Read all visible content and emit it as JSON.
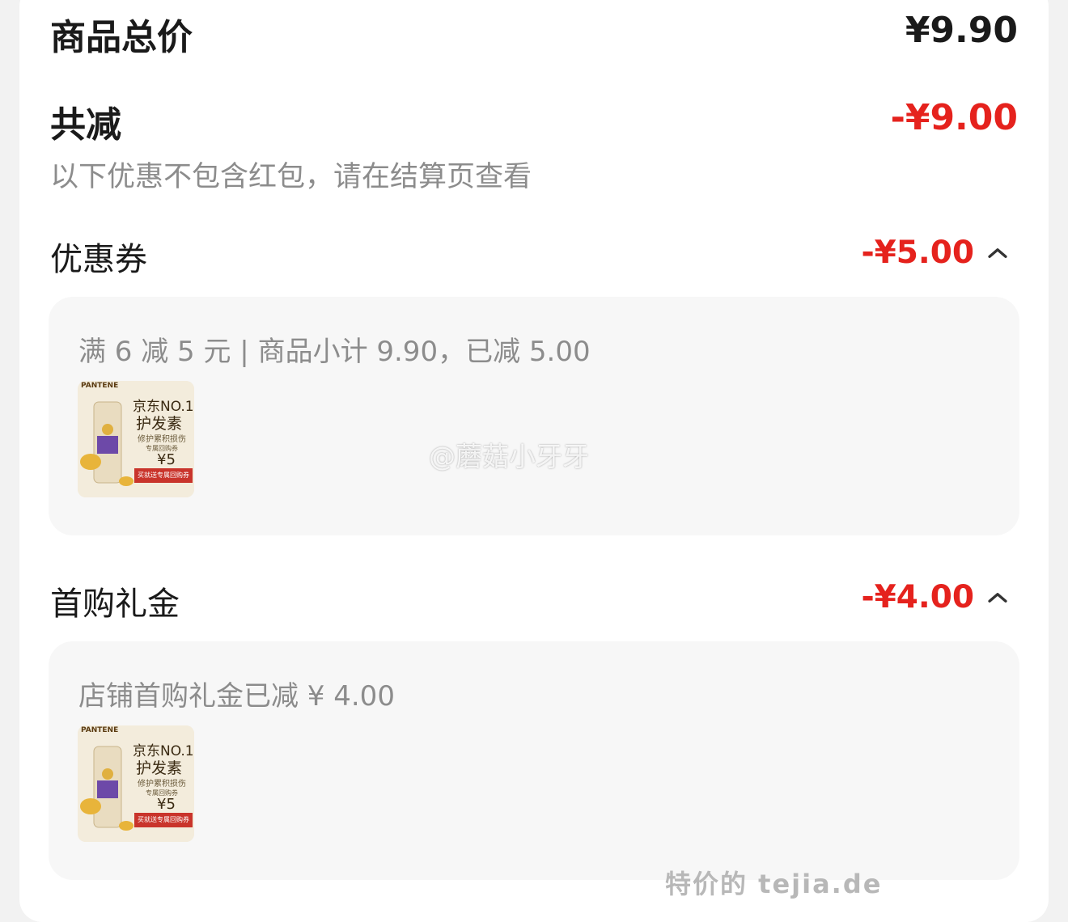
{
  "summary": {
    "total_label": "商品总价",
    "total_value": "¥9.90",
    "reduce_label": "共减",
    "reduce_value": "-¥9.00",
    "note": "以下优惠不包含红包，请在结算页查看"
  },
  "sections": [
    {
      "title": "优惠券",
      "amount": "-¥5.00",
      "detail": "满 6 减 5 元 | 商品小计 9.90，已减 5.00"
    },
    {
      "title": "首购礼金",
      "amount": "-¥4.00",
      "detail": "店铺首购礼金已减 ¥ 4.00"
    }
  ],
  "product_image": {
    "brand": "PANTENE",
    "slogan_line1": "京东NO.1",
    "slogan_line2": "护发素",
    "subline": "修护累积损伤",
    "gift": "专属回购券",
    "coupon_value": "¥5",
    "band_text": "买就送专属回购券"
  },
  "watermark": "@蘑菇小牙牙",
  "footer_watermark": "特价的 tejia.de",
  "colors": {
    "accent_red": "#e5221d",
    "muted_text": "#8c8c8c",
    "panel_bg": "#f7f7f7"
  }
}
